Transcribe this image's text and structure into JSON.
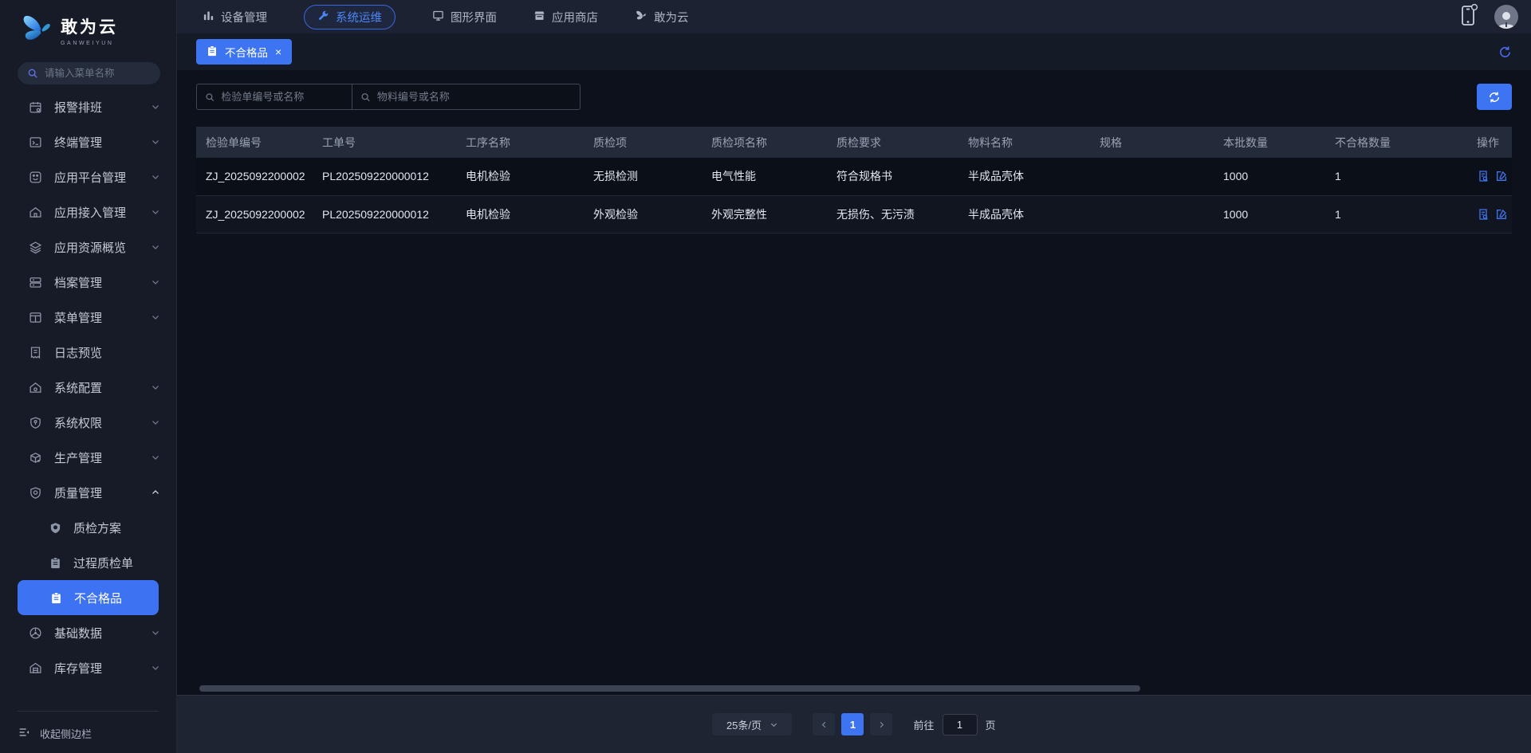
{
  "brand": {
    "name": "敢为云",
    "subtitle": "GANWEIYUN"
  },
  "topnav": {
    "items": [
      {
        "label": "设备管理",
        "icon": "device-chart-icon",
        "active": false
      },
      {
        "label": "系统运维",
        "icon": "wrench-icon",
        "active": true
      },
      {
        "label": "图形界面",
        "icon": "monitor-icon",
        "active": false
      },
      {
        "label": "应用商店",
        "icon": "store-icon",
        "active": false
      },
      {
        "label": "敢为云",
        "icon": "butterfly-icon",
        "active": false
      }
    ]
  },
  "tabbar": {
    "tab_label": "不合格品",
    "close_glyph": "×"
  },
  "sidebar": {
    "search_placeholder": "请输入菜单名称",
    "items": [
      {
        "label": "报警排班"
      },
      {
        "label": "终端管理"
      },
      {
        "label": "应用平台管理"
      },
      {
        "label": "应用接入管理"
      },
      {
        "label": "应用资源概览"
      },
      {
        "label": "档案管理"
      },
      {
        "label": "菜单管理"
      },
      {
        "label": "日志预览"
      },
      {
        "label": "系统配置"
      },
      {
        "label": "系统权限"
      },
      {
        "label": "生产管理"
      },
      {
        "label": "质量管理"
      },
      {
        "label": "基础数据"
      },
      {
        "label": "库存管理"
      }
    ],
    "quality_children": [
      {
        "label": "质检方案",
        "active": false
      },
      {
        "label": "过程质检单",
        "active": false
      },
      {
        "label": "不合格品",
        "active": true
      }
    ],
    "collapse_label": "收起侧边栏"
  },
  "toolbar": {
    "search1_placeholder": "检验单编号或名称",
    "search2_placeholder": "物料编号或名称"
  },
  "table": {
    "columns": [
      "检验单编号",
      "工单号",
      "工序名称",
      "质检项",
      "质检项名称",
      "质检要求",
      "物料名称",
      "规格",
      "本批数量",
      "不合格数量",
      "操作"
    ],
    "rows": [
      {
        "inspection_no": "ZJ_2025092200002",
        "work_order": "PL202509220000012",
        "process": "电机检验",
        "item": "无损检测",
        "item_name": "电气性能",
        "requirement": "符合规格书",
        "material": "半成品壳体",
        "spec": "",
        "batch_qty": "1000",
        "defect_qty": "1"
      },
      {
        "inspection_no": "ZJ_2025092200002",
        "work_order": "PL202509220000012",
        "process": "电机检验",
        "item": "外观检验",
        "item_name": "外观完整性",
        "requirement": "无损伤、无污渍",
        "material": "半成品壳体",
        "spec": "",
        "batch_qty": "1000",
        "defect_qty": "1"
      }
    ]
  },
  "pagination": {
    "page_size": "25条/页",
    "current_page": "1",
    "goto_label": "前往",
    "goto_value": "1",
    "unit_label": "页"
  },
  "icons": [
    "search-icon",
    "chevron-down-icon",
    "chevron-up-icon",
    "refresh-icon",
    "sync-icon",
    "phone-icon",
    "avatar",
    "clipboard-icon",
    "view-record-icon",
    "edit-icon"
  ],
  "colors": {
    "accent": "#3d74f2",
    "active_nav": "#4e86f7",
    "sidebar_bg": "#161b27",
    "header_bg": "#232a3a"
  }
}
